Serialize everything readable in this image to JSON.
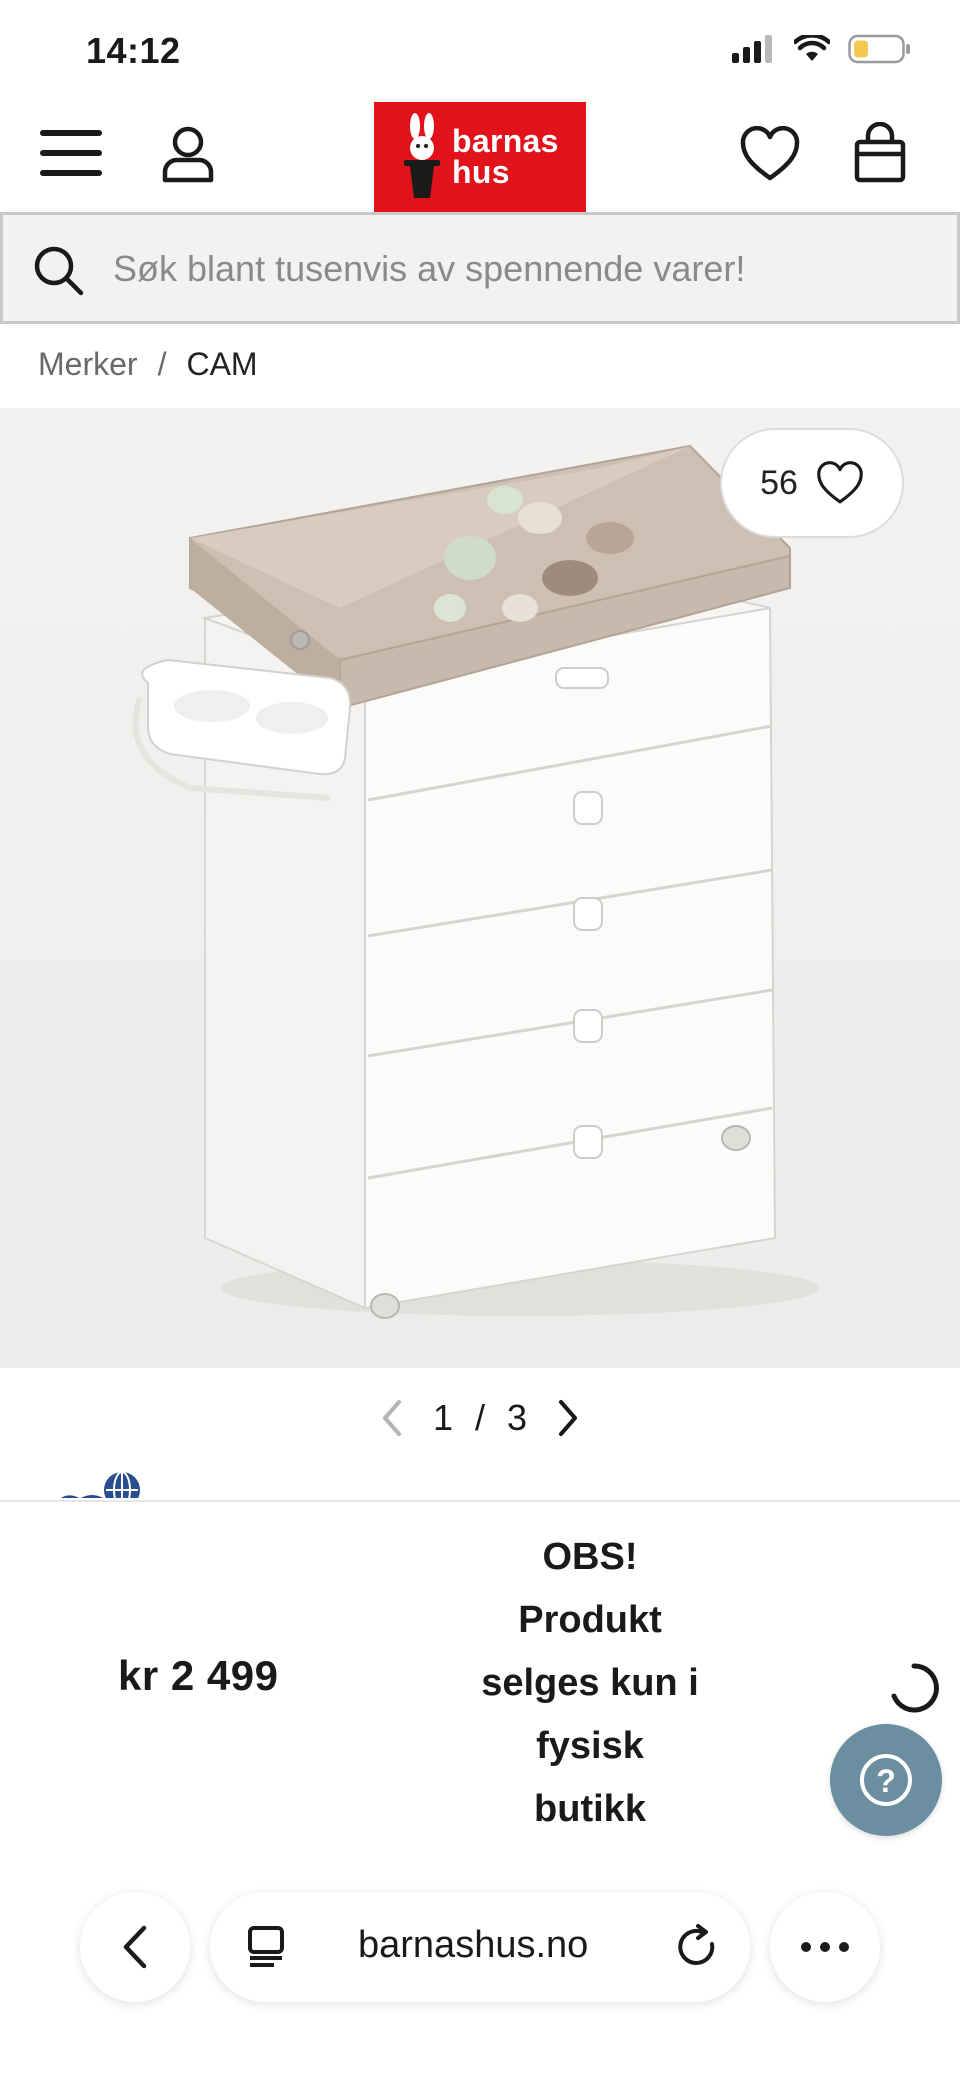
{
  "status_bar": {
    "time": "14:12"
  },
  "header": {
    "logo_line1": "barnas",
    "logo_line2": "hus",
    "icons": [
      "menu-icon",
      "user-icon",
      "heart-icon",
      "shopping-bag-icon"
    ]
  },
  "search": {
    "placeholder": "Søk blant tusenvis av spennende varer!"
  },
  "breadcrumb": {
    "items": [
      "Merker",
      "CAM"
    ],
    "separator": "/"
  },
  "product": {
    "favorite_count": "56",
    "image_description_icon": "changing-table-dresser-image"
  },
  "pager": {
    "current": "1",
    "separator": "/",
    "total": "3"
  },
  "buybar": {
    "price": "kr 2 499",
    "notice_lines": [
      "OBS!",
      "Produkt",
      "selges kun i",
      "fysisk",
      "butikk"
    ]
  },
  "help": {
    "label": "?"
  },
  "browser": {
    "url": "barnashus.no"
  },
  "colors": {
    "brand_red": "#e1121a",
    "help_button": "#6b8fa0",
    "battery": "#f2c94c"
  }
}
